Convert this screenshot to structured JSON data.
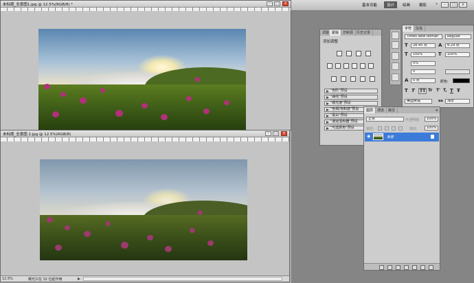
{
  "doc1": {
    "title": "未标题_全景图1.jpg @ 12.5%(RGB/8) *"
  },
  "doc2": {
    "title": "未标题_全景图 2.jpg @ 12.5%(RGB/8)",
    "zoom": "12.5%",
    "status": "曝光只在 32 位起作用"
  },
  "workspace": {
    "essentials": "基本功能",
    "design": "设计",
    "painting": "绘画",
    "photography": "摄影",
    "overflow": "»"
  },
  "adjustments": {
    "tabs": [
      "调整",
      "蒙版",
      "仿制源",
      "历史记录"
    ],
    "header": "添加调整",
    "presets": [
      "\"色阶\"预设",
      "\"曲线\"预设",
      "\"曝光度\"预设",
      "\"色相/饱和度\"预设",
      "\"黑白\"预设",
      "\"通道混和器\"预设",
      "\"可选颜色\"预设"
    ]
  },
  "character": {
    "tabs": [
      "字符",
      "段落"
    ],
    "font": "Times New Roman",
    "style": "Regular",
    "size": "28.45 点",
    "leading": "8.29 点",
    "tracking_pct": "0%",
    "scale_v": "100%",
    "scale_h": "100%",
    "kerning": "0",
    "baseline": "0 点",
    "color_label": "颜色:",
    "language": "美国英语",
    "antialias": "浑厚",
    "aa_label": "aa",
    "type_buttons": [
      "T",
      "T",
      "TT",
      "Tr",
      "T'",
      "T,",
      "T",
      "Ŧ"
    ]
  },
  "layers": {
    "tabs": [
      "图层",
      "通道",
      "路径"
    ],
    "blend": "正常",
    "opacity_label": "不透明度:",
    "opacity": "100%",
    "lock_label": "锁定:",
    "fill_label": "填充:",
    "fill": "100%",
    "layer_name": "背景"
  }
}
